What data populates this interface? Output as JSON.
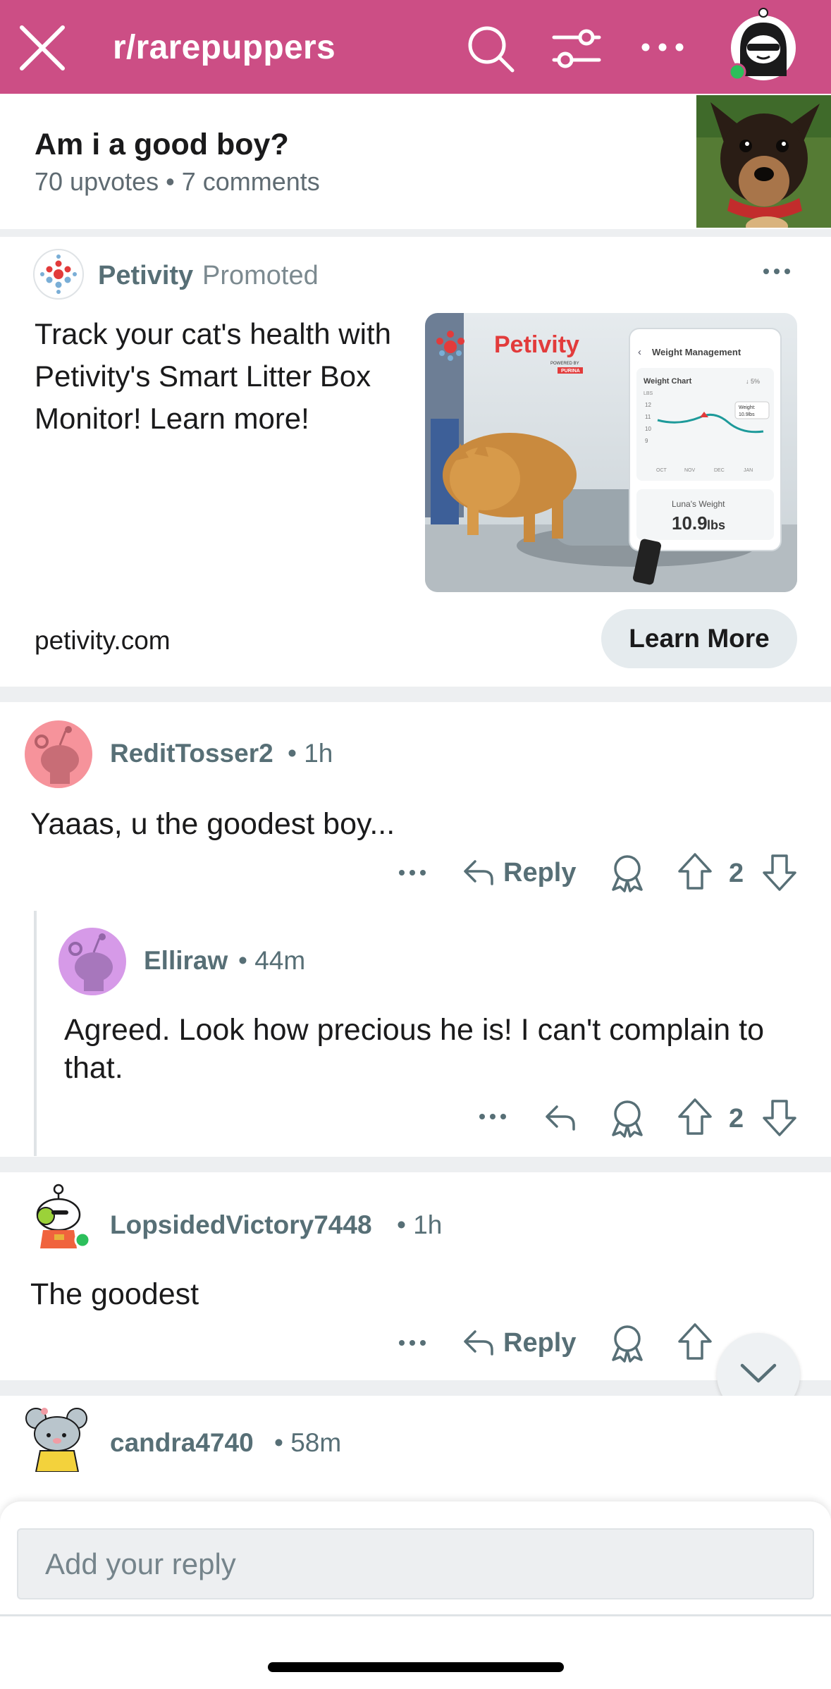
{
  "header": {
    "subreddit": "r/rarepuppers",
    "bg_color": "#cc4e85",
    "icons": [
      "close-icon",
      "search-icon",
      "filter-icon",
      "more-icon",
      "user-avatar"
    ]
  },
  "post": {
    "title": "Am i a good boy?",
    "meta": "70 upvotes • 7 comments"
  },
  "ad": {
    "brand": "Petivity",
    "promoted_label": "Promoted",
    "text": "Track your cat's health with Petivity's Smart Litter Box Monitor! Learn more!",
    "domain": "petivity.com",
    "cta": "Learn More",
    "image": {
      "brand": "Petivity",
      "powered_by": "POWERED BY",
      "purina": "PURINA",
      "panel_title": "Weight Management",
      "chart_title": "Weight Chart",
      "chart_change": "↓ 5%",
      "unit": "LBS",
      "y_ticks": [
        "12",
        "11",
        "10",
        "9"
      ],
      "months": [
        "OCT",
        "NOV",
        "DEC",
        "JAN"
      ],
      "tooltip_label": "Weight:",
      "tooltip_value": "10.9lbs",
      "weight_label": "Luna's Weight",
      "weight_value": "10.9",
      "weight_unit": "lbs"
    }
  },
  "comments": [
    {
      "user": "ReditTosser2",
      "time": "• 1h",
      "body": "Yaaas, u the goodest boy...",
      "reply_label": "Reply",
      "votes": "2"
    },
    {
      "user": "Elliraw",
      "time": "• 44m",
      "body": "Agreed. Look how precious he is! I  can't complain to that.",
      "votes": "2"
    },
    {
      "user": "LopsidedVictory7448",
      "time": "• 1h",
      "body": "The goodest",
      "reply_label": "Reply"
    },
    {
      "user": "candra4740",
      "time": "• 58m"
    }
  ],
  "reply_bar": {
    "placeholder": "Add your reply"
  }
}
